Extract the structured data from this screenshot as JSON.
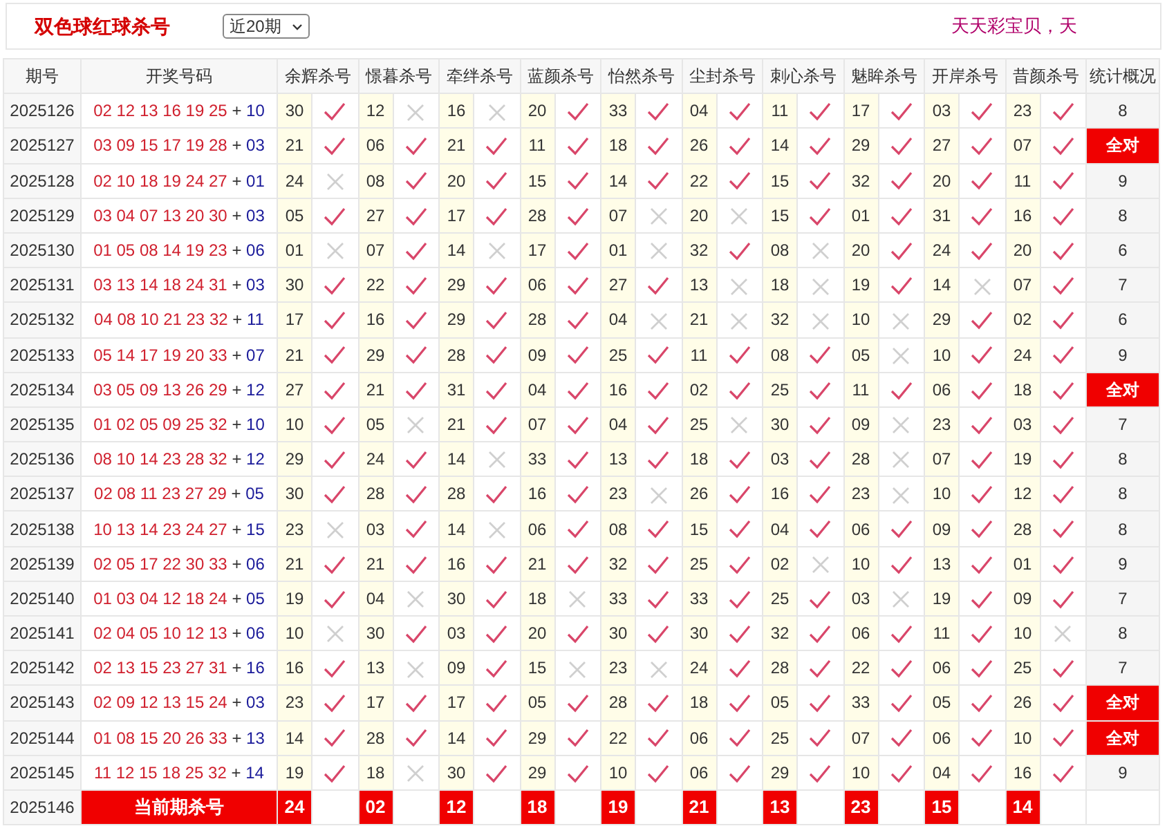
{
  "header": {
    "title": "双色球红球杀号",
    "period_select": "近20期",
    "slogan": "天天彩宝贝，天"
  },
  "columns": [
    "期号",
    "开奖号码",
    "余辉杀号",
    "憬暮杀号",
    "牵绊杀号",
    "蓝颜杀号",
    "怡然杀号",
    "尘封杀号",
    "刺心杀号",
    "魅眸杀号",
    "开岸杀号",
    "昔颜杀号",
    "统计概况"
  ],
  "rows": [
    {
      "issue": "2025126",
      "draw": [
        "02 12 13 16 19 25",
        "+",
        "10"
      ],
      "kills": [
        [
          "30",
          true
        ],
        [
          "12",
          false
        ],
        [
          "16",
          false
        ],
        [
          "20",
          true
        ],
        [
          "33",
          true
        ],
        [
          "04",
          true
        ],
        [
          "11",
          true
        ],
        [
          "17",
          true
        ],
        [
          "03",
          true
        ],
        [
          "23",
          true
        ]
      ],
      "summary": {
        "text": "8",
        "all_correct": false
      }
    },
    {
      "issue": "2025127",
      "draw": [
        "03 09 15 17 19 28",
        "+",
        "03"
      ],
      "kills": [
        [
          "21",
          true
        ],
        [
          "06",
          true
        ],
        [
          "21",
          true
        ],
        [
          "11",
          true
        ],
        [
          "18",
          true
        ],
        [
          "26",
          true
        ],
        [
          "14",
          true
        ],
        [
          "29",
          true
        ],
        [
          "27",
          true
        ],
        [
          "07",
          true
        ]
      ],
      "summary": {
        "text": "全对",
        "all_correct": true
      }
    },
    {
      "issue": "2025128",
      "draw": [
        "02 10 18 19 24 27",
        "+",
        "01"
      ],
      "kills": [
        [
          "24",
          false
        ],
        [
          "08",
          true
        ],
        [
          "20",
          true
        ],
        [
          "15",
          true
        ],
        [
          "14",
          true
        ],
        [
          "22",
          true
        ],
        [
          "15",
          true
        ],
        [
          "32",
          true
        ],
        [
          "20",
          true
        ],
        [
          "11",
          true
        ]
      ],
      "summary": {
        "text": "9",
        "all_correct": false
      }
    },
    {
      "issue": "2025129",
      "draw": [
        "03 04 07 13 20 30",
        "+",
        "03"
      ],
      "kills": [
        [
          "05",
          true
        ],
        [
          "27",
          true
        ],
        [
          "17",
          true
        ],
        [
          "28",
          true
        ],
        [
          "07",
          false
        ],
        [
          "20",
          false
        ],
        [
          "15",
          true
        ],
        [
          "01",
          true
        ],
        [
          "31",
          true
        ],
        [
          "16",
          true
        ]
      ],
      "summary": {
        "text": "8",
        "all_correct": false
      }
    },
    {
      "issue": "2025130",
      "draw": [
        "01 05 08 14 19 23",
        "+",
        "06"
      ],
      "kills": [
        [
          "01",
          false
        ],
        [
          "07",
          true
        ],
        [
          "14",
          false
        ],
        [
          "17",
          true
        ],
        [
          "01",
          false
        ],
        [
          "32",
          true
        ],
        [
          "08",
          false
        ],
        [
          "20",
          true
        ],
        [
          "24",
          true
        ],
        [
          "20",
          true
        ]
      ],
      "summary": {
        "text": "6",
        "all_correct": false
      }
    },
    {
      "issue": "2025131",
      "draw": [
        "03 13 14 18 24 31",
        "+",
        "03"
      ],
      "kills": [
        [
          "30",
          true
        ],
        [
          "22",
          true
        ],
        [
          "29",
          true
        ],
        [
          "06",
          true
        ],
        [
          "27",
          true
        ],
        [
          "13",
          false
        ],
        [
          "18",
          false
        ],
        [
          "19",
          true
        ],
        [
          "14",
          false
        ],
        [
          "07",
          true
        ]
      ],
      "summary": {
        "text": "7",
        "all_correct": false
      }
    },
    {
      "issue": "2025132",
      "draw": [
        "04 08 10 21 23 32",
        "+",
        "11"
      ],
      "kills": [
        [
          "17",
          true
        ],
        [
          "16",
          true
        ],
        [
          "29",
          true
        ],
        [
          "28",
          true
        ],
        [
          "04",
          false
        ],
        [
          "21",
          false
        ],
        [
          "32",
          false
        ],
        [
          "10",
          false
        ],
        [
          "29",
          true
        ],
        [
          "02",
          true
        ]
      ],
      "summary": {
        "text": "6",
        "all_correct": false
      }
    },
    {
      "issue": "2025133",
      "draw": [
        "05 14 17 19 20 33",
        "+",
        "07"
      ],
      "kills": [
        [
          "21",
          true
        ],
        [
          "29",
          true
        ],
        [
          "28",
          true
        ],
        [
          "09",
          true
        ],
        [
          "25",
          true
        ],
        [
          "11",
          true
        ],
        [
          "08",
          true
        ],
        [
          "05",
          false
        ],
        [
          "10",
          true
        ],
        [
          "24",
          true
        ]
      ],
      "summary": {
        "text": "9",
        "all_correct": false
      }
    },
    {
      "issue": "2025134",
      "draw": [
        "03 05 09 13 26 29",
        "+",
        "12"
      ],
      "kills": [
        [
          "27",
          true
        ],
        [
          "21",
          true
        ],
        [
          "31",
          true
        ],
        [
          "04",
          true
        ],
        [
          "16",
          true
        ],
        [
          "02",
          true
        ],
        [
          "25",
          true
        ],
        [
          "11",
          true
        ],
        [
          "06",
          true
        ],
        [
          "18",
          true
        ]
      ],
      "summary": {
        "text": "全对",
        "all_correct": true
      }
    },
    {
      "issue": "2025135",
      "draw": [
        "01 02 05 09 25 32",
        "+",
        "10"
      ],
      "kills": [
        [
          "10",
          true
        ],
        [
          "05",
          false
        ],
        [
          "21",
          true
        ],
        [
          "07",
          true
        ],
        [
          "04",
          true
        ],
        [
          "25",
          false
        ],
        [
          "30",
          true
        ],
        [
          "09",
          false
        ],
        [
          "23",
          true
        ],
        [
          "03",
          true
        ]
      ],
      "summary": {
        "text": "7",
        "all_correct": false
      }
    },
    {
      "issue": "2025136",
      "draw": [
        "08 10 14 23 28 32",
        "+",
        "12"
      ],
      "kills": [
        [
          "29",
          true
        ],
        [
          "24",
          true
        ],
        [
          "14",
          false
        ],
        [
          "33",
          true
        ],
        [
          "13",
          true
        ],
        [
          "18",
          true
        ],
        [
          "03",
          true
        ],
        [
          "28",
          false
        ],
        [
          "07",
          true
        ],
        [
          "19",
          true
        ]
      ],
      "summary": {
        "text": "8",
        "all_correct": false
      }
    },
    {
      "issue": "2025137",
      "draw": [
        "02 08 11 23 27 29",
        "+",
        "05"
      ],
      "kills": [
        [
          "30",
          true
        ],
        [
          "28",
          true
        ],
        [
          "28",
          true
        ],
        [
          "16",
          true
        ],
        [
          "23",
          false
        ],
        [
          "26",
          true
        ],
        [
          "16",
          true
        ],
        [
          "23",
          false
        ],
        [
          "10",
          true
        ],
        [
          "12",
          true
        ]
      ],
      "summary": {
        "text": "8",
        "all_correct": false
      }
    },
    {
      "issue": "2025138",
      "draw": [
        "10 13 14 23 24 27",
        "+",
        "15"
      ],
      "kills": [
        [
          "23",
          false
        ],
        [
          "03",
          true
        ],
        [
          "14",
          false
        ],
        [
          "06",
          true
        ],
        [
          "08",
          true
        ],
        [
          "15",
          true
        ],
        [
          "04",
          true
        ],
        [
          "06",
          true
        ],
        [
          "09",
          true
        ],
        [
          "28",
          true
        ]
      ],
      "summary": {
        "text": "8",
        "all_correct": false
      }
    },
    {
      "issue": "2025139",
      "draw": [
        "02 05 17 22 30 33",
        "+",
        "06"
      ],
      "kills": [
        [
          "21",
          true
        ],
        [
          "21",
          true
        ],
        [
          "16",
          true
        ],
        [
          "21",
          true
        ],
        [
          "32",
          true
        ],
        [
          "25",
          true
        ],
        [
          "02",
          false
        ],
        [
          "10",
          true
        ],
        [
          "13",
          true
        ],
        [
          "01",
          true
        ]
      ],
      "summary": {
        "text": "9",
        "all_correct": false
      }
    },
    {
      "issue": "2025140",
      "draw": [
        "01 03 04 12 18 24",
        "+",
        "05"
      ],
      "kills": [
        [
          "19",
          true
        ],
        [
          "04",
          false
        ],
        [
          "30",
          true
        ],
        [
          "18",
          false
        ],
        [
          "33",
          true
        ],
        [
          "33",
          true
        ],
        [
          "25",
          true
        ],
        [
          "03",
          false
        ],
        [
          "19",
          true
        ],
        [
          "09",
          true
        ]
      ],
      "summary": {
        "text": "7",
        "all_correct": false
      }
    },
    {
      "issue": "2025141",
      "draw": [
        "02 04 05 10 12 13",
        "+",
        "06"
      ],
      "kills": [
        [
          "10",
          false
        ],
        [
          "30",
          true
        ],
        [
          "03",
          true
        ],
        [
          "20",
          true
        ],
        [
          "30",
          true
        ],
        [
          "30",
          true
        ],
        [
          "32",
          true
        ],
        [
          "06",
          true
        ],
        [
          "11",
          true
        ],
        [
          "10",
          false
        ]
      ],
      "summary": {
        "text": "8",
        "all_correct": false
      }
    },
    {
      "issue": "2025142",
      "draw": [
        "02 13 15 23 27 31",
        "+",
        "16"
      ],
      "kills": [
        [
          "16",
          true
        ],
        [
          "13",
          false
        ],
        [
          "09",
          true
        ],
        [
          "15",
          false
        ],
        [
          "23",
          false
        ],
        [
          "24",
          true
        ],
        [
          "28",
          true
        ],
        [
          "22",
          true
        ],
        [
          "06",
          true
        ],
        [
          "25",
          true
        ]
      ],
      "summary": {
        "text": "7",
        "all_correct": false
      }
    },
    {
      "issue": "2025143",
      "draw": [
        "02 09 12 13 15 24",
        "+",
        "03"
      ],
      "kills": [
        [
          "23",
          true
        ],
        [
          "17",
          true
        ],
        [
          "17",
          true
        ],
        [
          "05",
          true
        ],
        [
          "28",
          true
        ],
        [
          "18",
          true
        ],
        [
          "05",
          true
        ],
        [
          "33",
          true
        ],
        [
          "05",
          true
        ],
        [
          "26",
          true
        ]
      ],
      "summary": {
        "text": "全对",
        "all_correct": true
      }
    },
    {
      "issue": "2025144",
      "draw": [
        "01 08 15 20 26 33",
        "+",
        "13"
      ],
      "kills": [
        [
          "14",
          true
        ],
        [
          "28",
          true
        ],
        [
          "14",
          true
        ],
        [
          "29",
          true
        ],
        [
          "22",
          true
        ],
        [
          "06",
          true
        ],
        [
          "25",
          true
        ],
        [
          "07",
          true
        ],
        [
          "06",
          true
        ],
        [
          "10",
          true
        ]
      ],
      "summary": {
        "text": "全对",
        "all_correct": true
      }
    },
    {
      "issue": "2025145",
      "draw": [
        "11 12 15 18 25 32",
        "+",
        "14"
      ],
      "kills": [
        [
          "19",
          true
        ],
        [
          "18",
          false
        ],
        [
          "30",
          true
        ],
        [
          "29",
          true
        ],
        [
          "10",
          true
        ],
        [
          "06",
          true
        ],
        [
          "29",
          true
        ],
        [
          "10",
          true
        ],
        [
          "04",
          true
        ],
        [
          "16",
          true
        ]
      ],
      "summary": {
        "text": "9",
        "all_correct": false
      }
    }
  ],
  "current": {
    "issue": "2025146",
    "label": "当前期杀号",
    "kills": [
      "24",
      "02",
      "12",
      "18",
      "19",
      "21",
      "13",
      "23",
      "15",
      "14"
    ]
  }
}
